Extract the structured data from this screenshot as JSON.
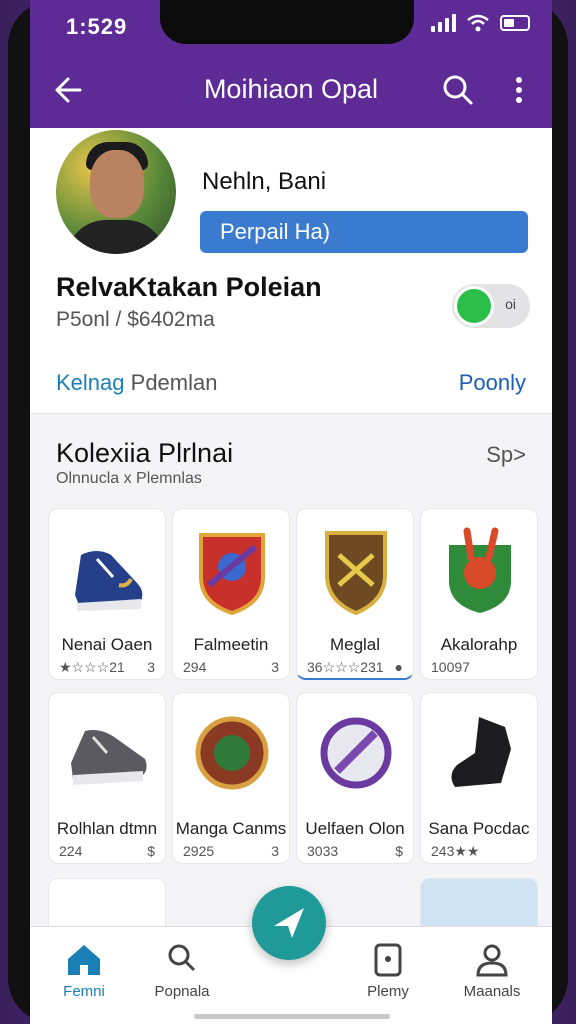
{
  "status_bar": {
    "time": "1:529"
  },
  "app_bar": {
    "title": "Moihiaon Opal"
  },
  "profile": {
    "name": "Nehln, Bani",
    "button_label": "Perpail Ha)"
  },
  "section": {
    "title": "RelvaKtakan Poleian",
    "subtitle": "P5onl / $6402ma",
    "toggle_label": "oi",
    "link_primary": "Kelnag",
    "link_secondary": "Pdemlan",
    "link_right": "Poonly"
  },
  "collection": {
    "title": "Kolexiia Plrlnai",
    "subtitle": "Olnnucla x Plemnlas",
    "see_more": "Sp>",
    "items": [
      {
        "name": "Nenai Oaen",
        "meta_left": "★☆☆☆21",
        "meta_right": "3",
        "icon": "sneaker-blue-icon"
      },
      {
        "name": "Falmeetin",
        "meta_left": "294",
        "meta_right": "3",
        "icon": "shield-red-icon"
      },
      {
        "name": "Meglal",
        "meta_left": "36☆☆☆231",
        "meta_right": "●",
        "icon": "shield-gold-icon"
      },
      {
        "name": "Akalorahp",
        "meta_left": "10097",
        "meta_right": "",
        "icon": "rabbit-badge-icon"
      },
      {
        "name": "Rolhlan dtmn",
        "meta_left": "224",
        "meta_right": "$",
        "icon": "sneaker-gray-icon"
      },
      {
        "name": "Manga Canms",
        "meta_left": "2925",
        "meta_right": "3",
        "icon": "medallion-icon"
      },
      {
        "name": "Uelfaen Olon",
        "meta_left": "3033",
        "meta_right": "$",
        "icon": "emblem-purple-icon"
      },
      {
        "name": "Sana Pocdac",
        "meta_left": "243★★",
        "meta_right": "",
        "icon": "boot-black-icon"
      }
    ]
  },
  "bottom_nav": [
    {
      "label": "Femni",
      "icon": "home-icon",
      "active": true
    },
    {
      "label": "Popnala",
      "icon": "search-person-icon",
      "active": false
    },
    {
      "label": "Plemy",
      "icon": "document-icon",
      "active": false
    },
    {
      "label": "Maanals",
      "icon": "person-icon",
      "active": false
    }
  ],
  "colors": {
    "brand_purple": "#5e2a96",
    "primary_blue": "#3a7bd0",
    "toggle_green": "#2bbf4a",
    "fab_teal": "#1f9a98",
    "link_blue": "#1a7fb5"
  }
}
